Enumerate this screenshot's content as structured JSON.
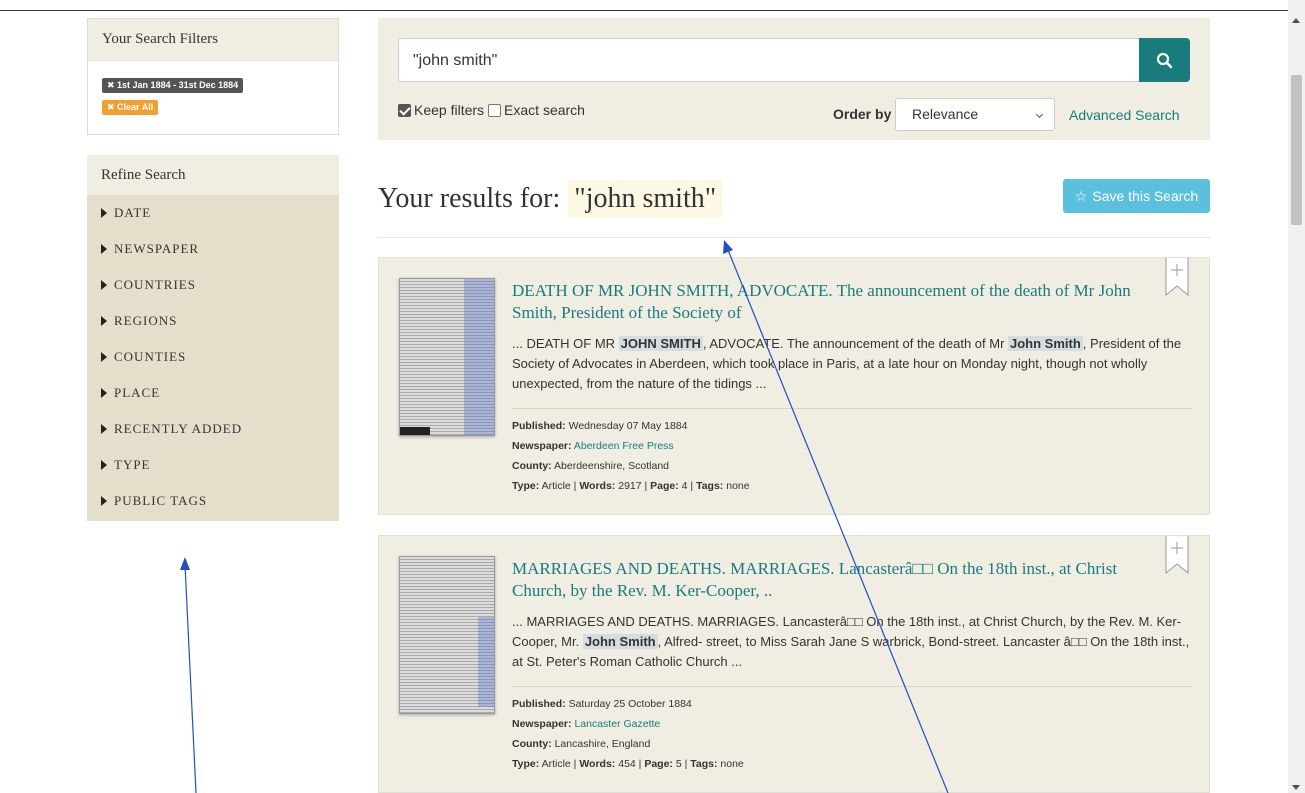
{
  "filters": {
    "heading": "Your Search Filters",
    "date_tag": "✖ 1st Jan 1884 - 31st Dec 1884",
    "clear_tag": "✖ Clear All"
  },
  "refine": {
    "heading": "Refine Search",
    "items": [
      "DATE",
      "NEWSPAPER",
      "COUNTRIES",
      "REGIONS",
      "COUNTIES",
      "PLACE",
      "RECENTLY ADDED",
      "TYPE",
      "PUBLIC TAGS"
    ]
  },
  "search": {
    "value": "\"john smith\"",
    "keep_filters": "Keep filters",
    "exact_search": "Exact search",
    "order_by_label": "Order by",
    "order_value": "Relevance",
    "advanced": "Advanced Search",
    "search_icon": "search-icon"
  },
  "results": {
    "prefix": "Your results for:",
    "query": "\"john smith\"",
    "save_label": "Save this Search",
    "save_icon": "star-icon"
  },
  "cards": [
    {
      "title": "DEATH OF MR JOHN SMITH, ADVOCATE. The announcement of the death of Mr John Smith, President of the Society of",
      "snippet_pre": "... DEATH OF MR ",
      "snippet_hl1": "JOHN SMITH",
      "snippet_mid": ", ADVOCATE. The announcement of the death of Mr ",
      "snippet_hl2": "John Smith",
      "snippet_post": ", President of the Society of Advocates in Aberdeen, which took place in Paris, at a late hour on Monday night, though not wholly unexpected, from the nature of the tidings ...",
      "published_label": "Published:",
      "published": "Wednesday 07 May 1884",
      "newspaper_label": "Newspaper:",
      "newspaper": "Aberdeen Free Press",
      "county_label": "County:",
      "county": "Aberdeenshire, Scotland",
      "type_label": "Type:",
      "type": "Article",
      "words_label": "Words:",
      "words": "2917",
      "page_label": "Page:",
      "page": "4",
      "tags_label": "Tags:",
      "tags": "none"
    },
    {
      "title": "MARRIAGES AND DEATHS. MARRIAGES. Lancasterâ□□ On the 18th inst., at Christ Church, by the Rev. M. Ker-Cooper, ..",
      "snippet_pre": "... MARRIAGES AND DEATHS. MARRIAGES. Lancasterâ□□ On the 18th inst., at Christ Church, by the Rev. M. Ker-Cooper, Mr. ",
      "snippet_hl1": "John Smith",
      "snippet_mid": ", Alfred- street, to Miss Sarah Jane S warbrick, Bond-street. Lancaster â□□ On the 18th inst., at St. Peter's Roman Catholic Church ...",
      "snippet_hl2": "",
      "snippet_post": "",
      "published_label": "Published:",
      "published": "Saturday 25 October 1884",
      "newspaper_label": "Newspaper:",
      "newspaper": "Lancaster Gazette",
      "county_label": "County:",
      "county": "Lancashire, England",
      "type_label": "Type:",
      "type": "Article",
      "words_label": "Words:",
      "words": "454",
      "page_label": "Page:",
      "page": "5",
      "tags_label": "Tags:",
      "tags": "none"
    }
  ],
  "colors": {
    "accent": "#1a7b7d",
    "panel": "#f0eee3",
    "refine_bg": "#e4dfcb",
    "save_button": "#5bc0de",
    "annotation": "#2050c0"
  }
}
